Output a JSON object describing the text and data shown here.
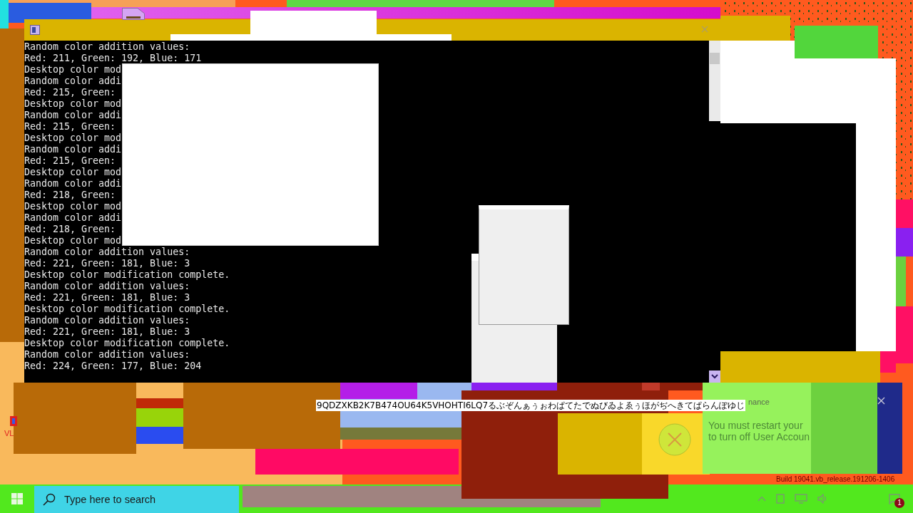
{
  "console_window": {
    "lines": [
      "Random color addition values:",
      "Red: 211, Green: 192, Blue: 171",
      "Desktop color mod",
      "Random color addi",
      "Red: 215, Green:",
      "Desktop color mod",
      "Random color addi",
      "Red: 215, Green:",
      "Desktop color mod",
      "Random color addi",
      "Red: 215, Green:",
      "Desktop color mod",
      "Random color addi",
      "Red: 218, Green:",
      "Desktop color mod",
      "Random color addi",
      "Red: 218, Green:",
      "Desktop color mod",
      "Random color addition values:",
      "Red: 221, Green: 181, Blue: 3",
      "Desktop color modification complete.",
      "Random color addition values:",
      "Red: 221, Green: 181, Blue: 3",
      "Desktop color modification complete.",
      "Random color addition values:",
      "Red: 221, Green: 181, Blue: 3",
      "Desktop color modification complete.",
      "Random color addition values:",
      "Red: 224, Green: 177, Blue: 204"
    ]
  },
  "overlay_text": "9QDZXKB2K7B474OU64K5VHOHTI6LQ7るぶぞんぁぅぉわぱてたでぬびゐよゑぅほがぢへきてぱらんぽゆじ",
  "notification": {
    "title": "nance",
    "lines": [
      "You must restart your",
      "to turn off User Accoun"
    ]
  },
  "desktop_icons": [
    {
      "label": "VL"
    }
  ],
  "build_text": "Build 19041.vb_release.191206-1406",
  "taskbar": {
    "search": {
      "placeholder": "Type here to search"
    },
    "notification_count": "1"
  }
}
